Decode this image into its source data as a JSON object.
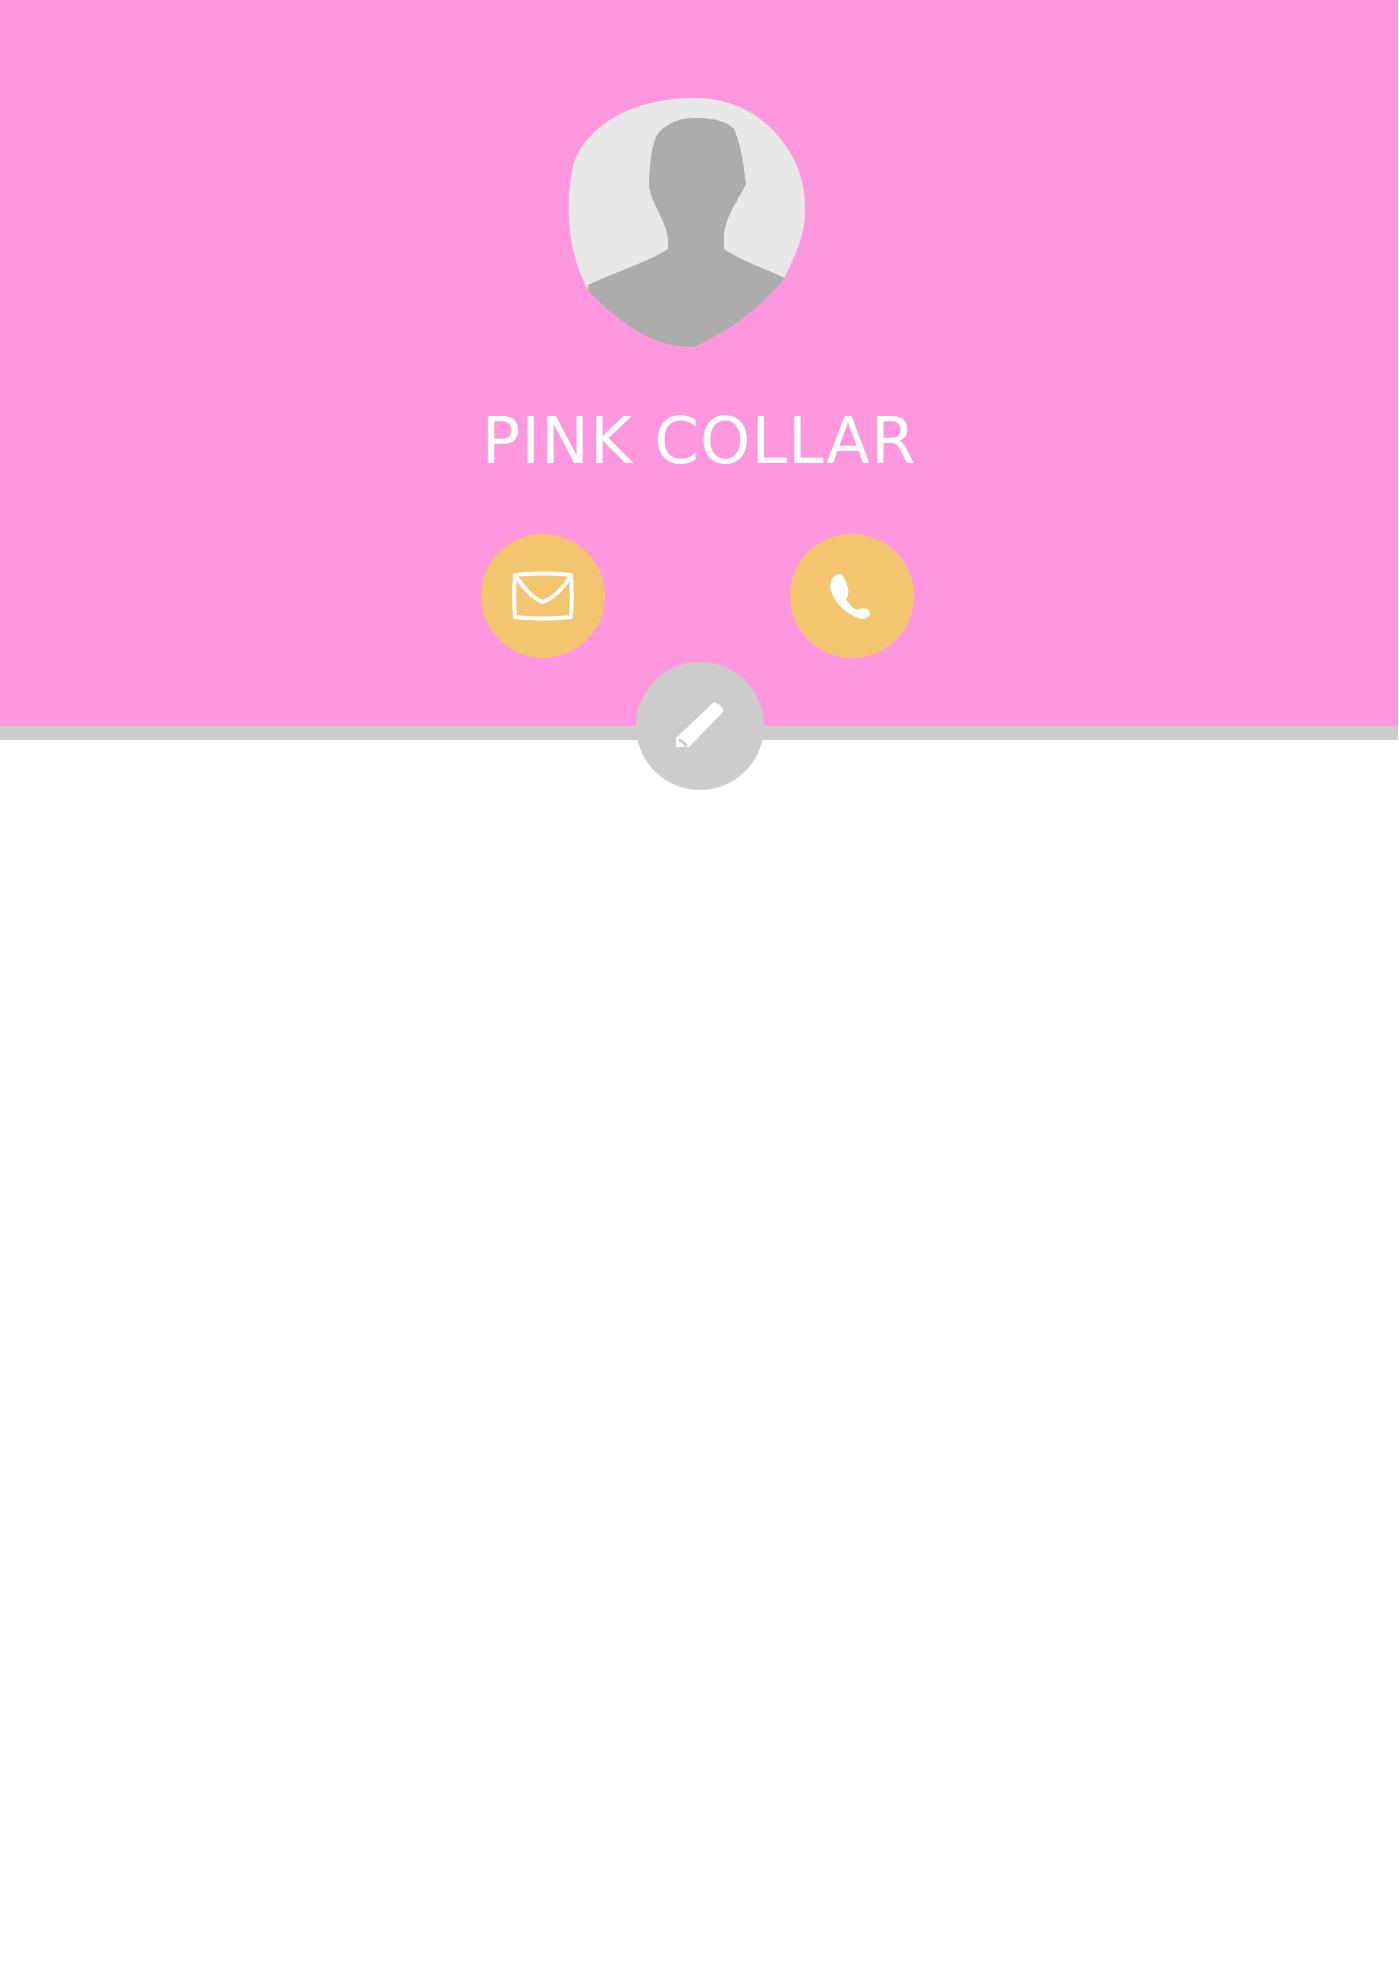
{
  "profile": {
    "name": "PINK COLLAR",
    "avatar_icon": "person-silhouette-icon"
  },
  "actions": {
    "email_icon": "envelope-icon",
    "phone_icon": "phone-icon",
    "edit_icon": "pencil-icon"
  },
  "colors": {
    "header_background": "#ff97de",
    "action_button": "#f4c56f",
    "edit_button": "#cccccc",
    "divider": "#cccccc",
    "avatar_background": "#e8e8e8",
    "avatar_silhouette": "#acacac"
  }
}
